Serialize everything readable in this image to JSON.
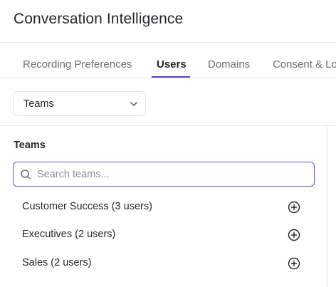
{
  "header": {
    "title": "Conversation Intelligence"
  },
  "tabs": [
    {
      "label": "Recording Preferences",
      "active": false
    },
    {
      "label": "Users",
      "active": true
    },
    {
      "label": "Domains",
      "active": false
    },
    {
      "label": "Consent & Lo",
      "active": false
    }
  ],
  "filter": {
    "selected": "Teams",
    "icon": "chevron-down-icon"
  },
  "teams_panel": {
    "title": "Teams",
    "search": {
      "placeholder": "Search teams...",
      "value": "",
      "icon": "search-icon"
    },
    "items": [
      {
        "label": "Customer Success (3 users)",
        "action_icon": "plus-circle-icon"
      },
      {
        "label": "Executives (2 users)",
        "action_icon": "plus-circle-icon"
      },
      {
        "label": "Sales (2 users)",
        "action_icon": "plus-circle-icon"
      }
    ]
  },
  "colors": {
    "accent": "#5b3fd1",
    "border": "#e6e6ea",
    "text": "#26272b",
    "muted": "#6b6d74"
  }
}
